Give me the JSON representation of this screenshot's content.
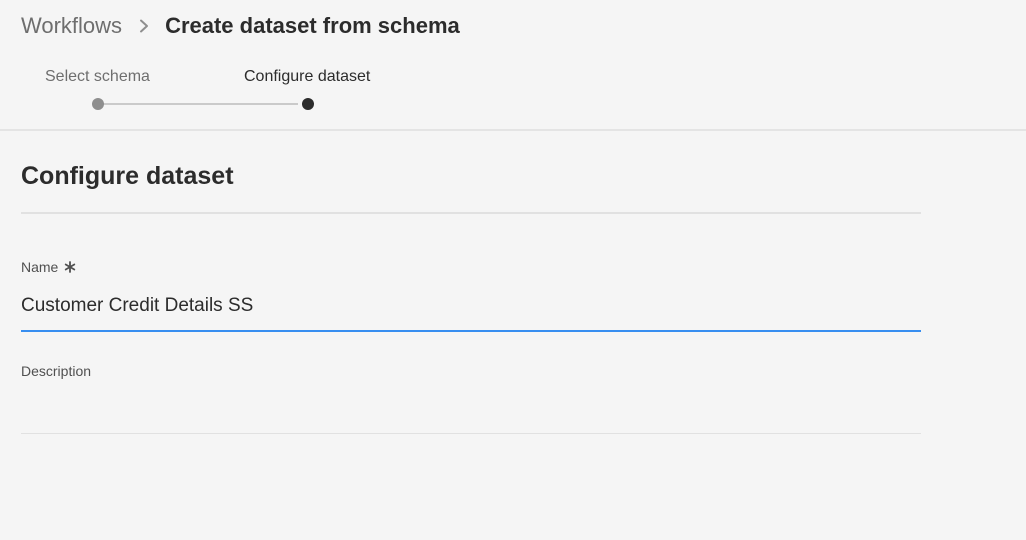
{
  "breadcrumb": {
    "parent": "Workflows",
    "current": "Create dataset from schema",
    "separator_icon": "chevron-right-icon"
  },
  "steps": [
    {
      "label": "Select schema",
      "state": "complete"
    },
    {
      "label": "Configure dataset",
      "state": "current"
    }
  ],
  "form": {
    "title": "Configure dataset",
    "name": {
      "label": "Name",
      "required": true,
      "required_icon": "asterisk-icon",
      "value": "Customer Credit Details SS"
    },
    "description": {
      "label": "Description",
      "value": ""
    }
  },
  "colors": {
    "background": "#f5f5f5",
    "focus_accent": "#378ef0",
    "text_primary": "#2c2c2c",
    "text_secondary": "#6e6e6e"
  }
}
